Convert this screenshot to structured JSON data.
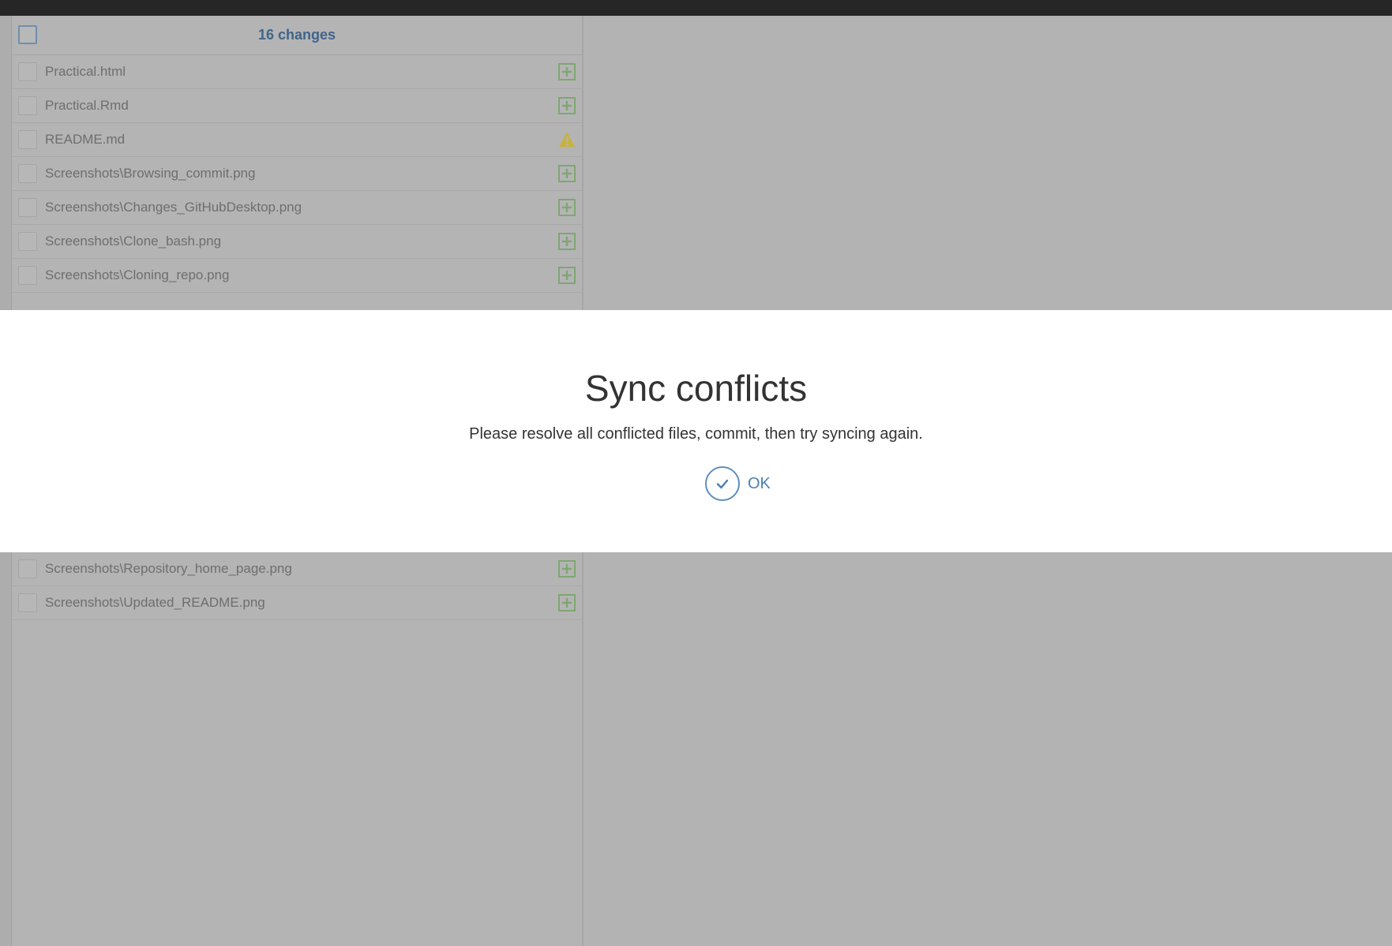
{
  "changes_panel": {
    "count_label": "16 changes",
    "files": [
      {
        "name": "Practical.html",
        "status": "added",
        "status_icon": "plus-box-icon"
      },
      {
        "name": "Practical.Rmd",
        "status": "added",
        "status_icon": "plus-box-icon"
      },
      {
        "name": "README.md",
        "status": "conflicted",
        "status_icon": "warning-icon"
      },
      {
        "name": "Screenshots\\Browsing_commit.png",
        "status": "added",
        "status_icon": "plus-box-icon"
      },
      {
        "name": "Screenshots\\Changes_GitHubDesktop.png",
        "status": "added",
        "status_icon": "plus-box-icon"
      },
      {
        "name": "Screenshots\\Clone_bash.png",
        "status": "added",
        "status_icon": "plus-box-icon"
      },
      {
        "name": "Screenshots\\Cloning_repo.png",
        "status": "added",
        "status_icon": "plus-box-icon"
      },
      {
        "name": "Screenshots\\Repository_home_page.png",
        "status": "added",
        "status_icon": "plus-box-icon"
      },
      {
        "name": "Screenshots\\Updated_README.png",
        "status": "added",
        "status_icon": "plus-box-icon"
      }
    ]
  },
  "dialog": {
    "title": "Sync conflicts",
    "message": "Please resolve all conflicted files, commit, then try syncing again.",
    "ok_label": "OK"
  },
  "colors": {
    "accent": "#4a7fb4",
    "added": "#7fa672",
    "warning": "#c9b23c",
    "overlay": "#b3b3b3"
  }
}
